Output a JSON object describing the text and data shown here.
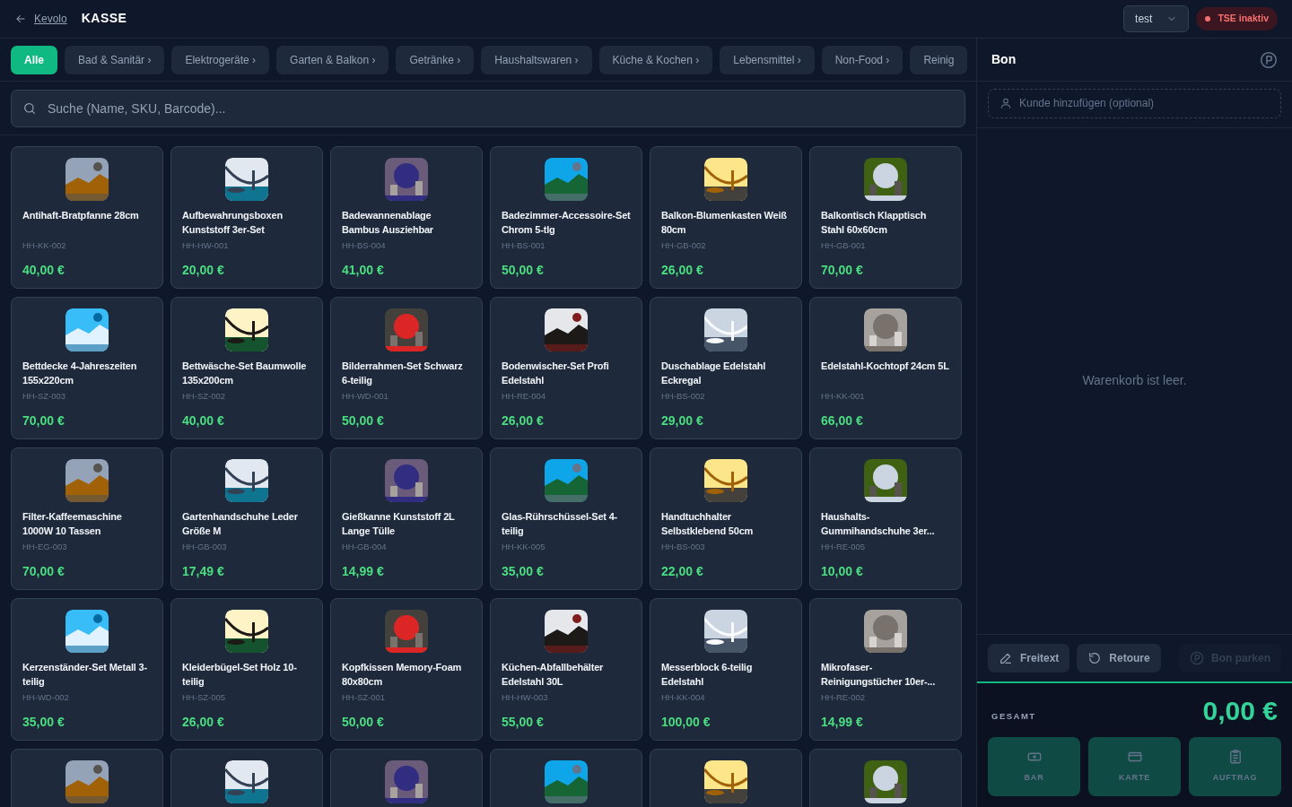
{
  "header": {
    "back_link": "Kevolo",
    "title": "KASSE",
    "user_select": "test",
    "tse_badge": "TSE inaktiv"
  },
  "categories": [
    {
      "label": "Alle",
      "selected": true
    },
    {
      "label": "Bad & Sanitär ›",
      "selected": false
    },
    {
      "label": "Elektrogeräte ›",
      "selected": false
    },
    {
      "label": "Garten & Balkon ›",
      "selected": false
    },
    {
      "label": "Getränke ›",
      "selected": false
    },
    {
      "label": "Haushaltswaren ›",
      "selected": false
    },
    {
      "label": "Küche & Kochen ›",
      "selected": false
    },
    {
      "label": "Lebensmittel ›",
      "selected": false
    },
    {
      "label": "Non-Food ›",
      "selected": false
    },
    {
      "label": "Reinig",
      "selected": false
    }
  ],
  "search": {
    "placeholder": "Suche (Name, SKU, Barcode)..."
  },
  "products": [
    {
      "kind": "full",
      "name": "Antihaft-Bratpfanne 28cm",
      "sku": "HH-KK-002",
      "price": "40,00 €"
    },
    {
      "kind": "full",
      "name": "Aufbewahrungsboxen Kunststoff 3er-Set",
      "sku": "HH-HW-001",
      "price": "20,00 €"
    },
    {
      "kind": "full",
      "name": "Badewannenablage Bambus Ausziehbar",
      "sku": "HH-BS-004",
      "price": "41,00 €"
    },
    {
      "kind": "full",
      "name": "Badezimmer-Accessoire-Set Chrom 5-tlg",
      "sku": "HH-BS-001",
      "price": "50,00 €"
    },
    {
      "kind": "full",
      "name": "Balkon-Blumenkasten Weiß 80cm",
      "sku": "HH-GB-002",
      "price": "26,00 €"
    },
    {
      "kind": "full",
      "name": "Balkontisch Klapptisch Stahl 60x60cm",
      "sku": "HH-GB-001",
      "price": "70,00 €"
    },
    {
      "kind": "full",
      "name": "Bettdecke 4-Jahreszeiten 155x220cm",
      "sku": "HH-SZ-003",
      "price": "70,00 €"
    },
    {
      "kind": "full",
      "name": "Bettwäsche-Set Baumwolle 135x200cm",
      "sku": "HH-SZ-002",
      "price": "40,00 €"
    },
    {
      "kind": "full",
      "name": "Bilderrahmen-Set Schwarz 6-teilig",
      "sku": "HH-WD-001",
      "price": "50,00 €"
    },
    {
      "kind": "full",
      "name": "Bodenwischer-Set Profi Edelstahl",
      "sku": "HH-RE-004",
      "price": "26,00 €"
    },
    {
      "kind": "full",
      "name": "Duschablage Edelstahl Eckregal",
      "sku": "HH-BS-002",
      "price": "29,00 €"
    },
    {
      "kind": "full",
      "name": "Edelstahl-Kochtopf 24cm 5L",
      "sku": "HH-KK-001",
      "price": "66,00 €"
    },
    {
      "kind": "full",
      "name": "Filter-Kaffeemaschine 1000W 10 Tassen",
      "sku": "HH-EG-003",
      "price": "70,00 €"
    },
    {
      "kind": "full",
      "name": "Gartenhandschuhe Leder Größe M",
      "sku": "HH-GB-003",
      "price": "17,49 €"
    },
    {
      "kind": "full",
      "name": "Gießkanne Kunststoff 2L Lange Tülle",
      "sku": "HH-GB-004",
      "price": "14,99 €"
    },
    {
      "kind": "full",
      "name": "Glas-Rührschüssel-Set 4-teilig",
      "sku": "HH-KK-005",
      "price": "35,00 €"
    },
    {
      "kind": "full",
      "name": "Handtuchhalter Selbstklebend 50cm",
      "sku": "HH-BS-003",
      "price": "22,00 €"
    },
    {
      "kind": "full",
      "name": "Haushalts-Gummihandschuhe 3er...",
      "sku": "HH-RE-005",
      "price": "10,00 €"
    },
    {
      "kind": "full",
      "name": "Kerzenständer-Set Metall 3-teilig",
      "sku": "HH-WD-002",
      "price": "35,00 €"
    },
    {
      "kind": "full",
      "name": "Kleiderbügel-Set Holz 10-teilig",
      "sku": "HH-SZ-005",
      "price": "26,00 €"
    },
    {
      "kind": "full",
      "name": "Kopfkissen Memory-Foam 80x80cm",
      "sku": "HH-SZ-001",
      "price": "50,00 €"
    },
    {
      "kind": "full",
      "name": "Küchen-Abfallbehälter Edelstahl 30L",
      "sku": "HH-HW-003",
      "price": "55,00 €"
    },
    {
      "kind": "full",
      "name": "Messerblock 6-teilig Edelstahl",
      "sku": "HH-KK-004",
      "price": "100,00 €"
    },
    {
      "kind": "full",
      "name": "Mikrofaser-Reinigungstücher 10er-...",
      "sku": "HH-RE-002",
      "price": "14,99 €"
    },
    {
      "kind": "cut"
    },
    {
      "kind": "cut"
    },
    {
      "kind": "cut"
    },
    {
      "kind": "cut"
    },
    {
      "kind": "cut"
    },
    {
      "kind": "cut"
    }
  ],
  "bon": {
    "title": "Bon",
    "customer_placeholder": "Kunde hinzufügen (optional)",
    "empty_text": "Warenkorb ist leer.",
    "actions": [
      {
        "kind": "pen",
        "label": "Freitext",
        "disabled": false
      },
      {
        "kind": "return",
        "label": "Retoure",
        "disabled": false
      },
      {
        "kind": "park",
        "label": "Bon parken",
        "disabled": true
      }
    ],
    "total_label": "GESAMT",
    "total": "0,00 €",
    "payments": [
      {
        "kind": "cash",
        "label": "BAR",
        "disabled": true
      },
      {
        "kind": "card",
        "label": "KARTE",
        "disabled": true
      },
      {
        "kind": "order",
        "label": "AUFTRAG",
        "disabled": true
      }
    ]
  }
}
